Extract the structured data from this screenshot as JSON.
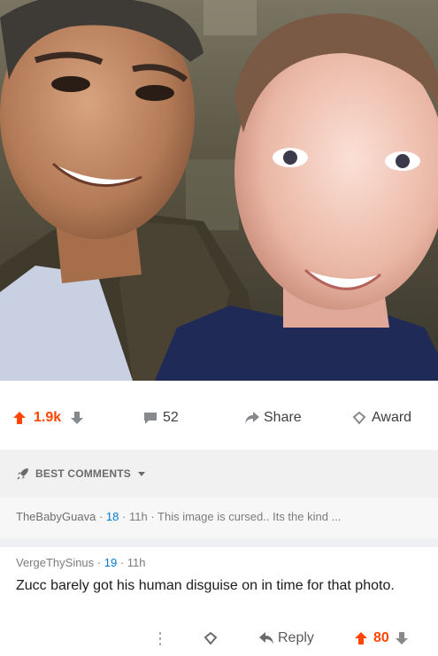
{
  "post": {
    "score": "1.9k",
    "comments": "52",
    "share_label": "Share",
    "award_label": "Award"
  },
  "sort": {
    "label": "BEST COMMENTS"
  },
  "collapsed_comment": {
    "user": "TheBabyGuava",
    "score": "18",
    "time": "11h",
    "text": "This image is cursed.. Its the kind ..."
  },
  "comment": {
    "user": "VergeThySinus",
    "score": "19",
    "time": "11h",
    "text": "Zucc barely got his human disguise on in time for that photo.",
    "more": "⋮",
    "reply_label": "Reply",
    "votes": "80"
  },
  "colors": {
    "upvote": "#ff4500",
    "accent": "#0079d3"
  },
  "icons": [
    "upvote-icon",
    "downvote-icon",
    "comment-icon",
    "share-icon",
    "award-icon",
    "rocket-icon",
    "chevron-down-icon",
    "more-icon",
    "reply-icon"
  ]
}
